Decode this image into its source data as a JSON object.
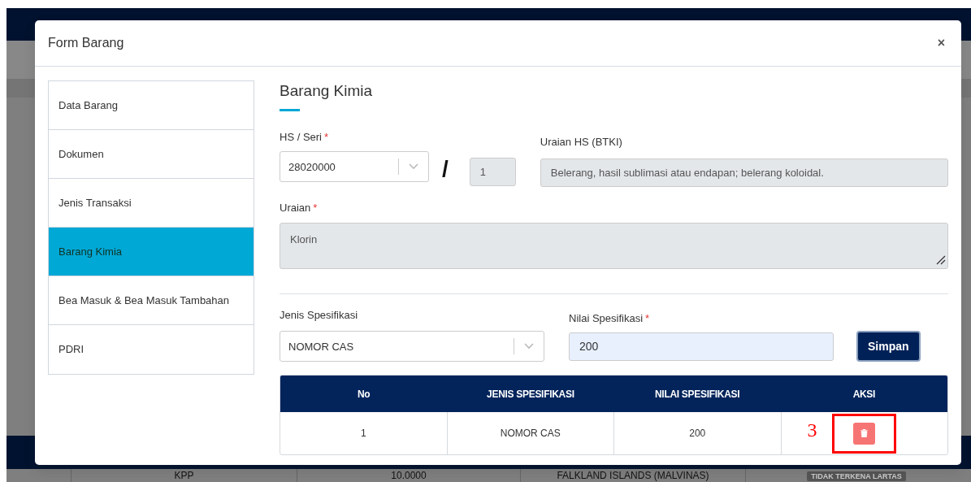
{
  "background": {
    "table_row": [
      "KPP",
      "10.0000",
      "FALKLAND ISLANDS (MALVINAS)"
    ],
    "badge": "TIDAK TERKENA LARTAS"
  },
  "modal": {
    "title": "Form Barang",
    "close": "×"
  },
  "sidebar": {
    "items": [
      {
        "label": "Data Barang",
        "selected": false
      },
      {
        "label": "Dokumen",
        "selected": false
      },
      {
        "label": "Jenis Transaksi",
        "selected": false
      },
      {
        "label": "Barang Kimia",
        "selected": true
      },
      {
        "label": "Bea Masuk & Bea Masuk Tambahan",
        "selected": false
      },
      {
        "label": "PDRI",
        "selected": false
      }
    ]
  },
  "section": {
    "title": "Barang Kimia"
  },
  "form": {
    "hs_label": "HS / Seri",
    "hs_required": "*",
    "hs_value": "28020000",
    "separator": "/",
    "seri_value": "1",
    "uraian_hs_label": "Uraian HS (BTKI)",
    "uraian_hs_value": "Belerang, hasil sublimasi atau endapan; belerang koloidal.",
    "uraian_label": "Uraian",
    "uraian_required": "*",
    "uraian_value": "Klorin"
  },
  "spec": {
    "jenis_label": "Jenis Spesifikasi",
    "jenis_value": "NOMOR CAS",
    "nilai_label": "Nilai Spesifikasi",
    "nilai_required": "*",
    "nilai_value": "200",
    "save_button": "Simpan"
  },
  "table": {
    "columns": [
      "No",
      "JENIS SPESIFIKASI",
      "NILAI SPESIFIKASI",
      "AKSI"
    ],
    "rows": [
      {
        "cells": [
          "1",
          "NOMOR CAS",
          "200"
        ]
      }
    ]
  },
  "annotation": {
    "label": "3"
  }
}
